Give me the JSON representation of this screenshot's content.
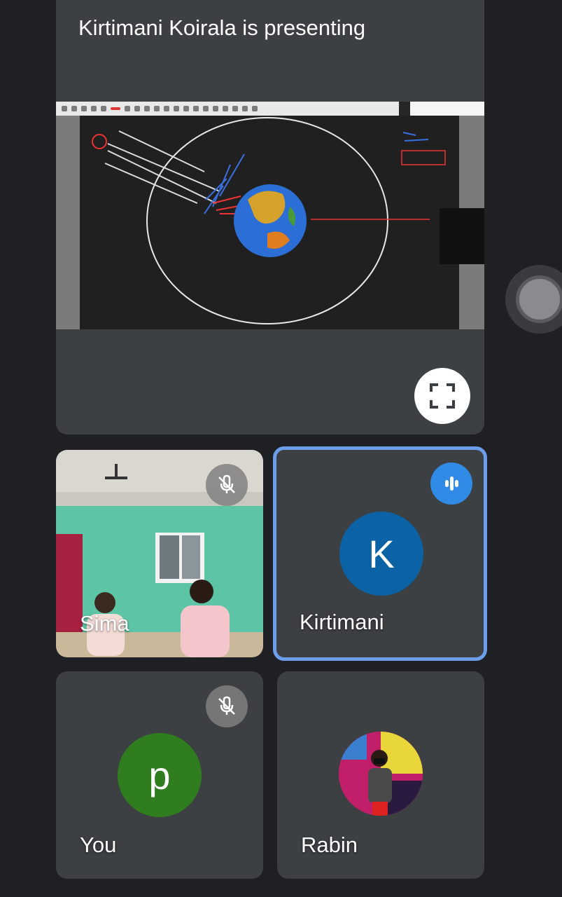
{
  "presentation": {
    "title": "Kirtimani Koirala is presenting",
    "fullscreen_icon": "fullscreen-icon"
  },
  "participants": [
    {
      "name": "Sima",
      "muted": true,
      "has_video": true
    },
    {
      "name": "Kirtimani",
      "initial": "K",
      "speaking": true,
      "avatar_color": "#0b62a4"
    },
    {
      "name": "You",
      "initial": "p",
      "muted": true,
      "avatar_color": "#2f7d1e"
    },
    {
      "name": "Rabin",
      "has_photo_avatar": true
    }
  ],
  "colors": {
    "background": "#1f2023",
    "tile": "#3c4043",
    "active_speaker_border": "#6d9eeb",
    "speaking_badge": "#2f8be6"
  }
}
